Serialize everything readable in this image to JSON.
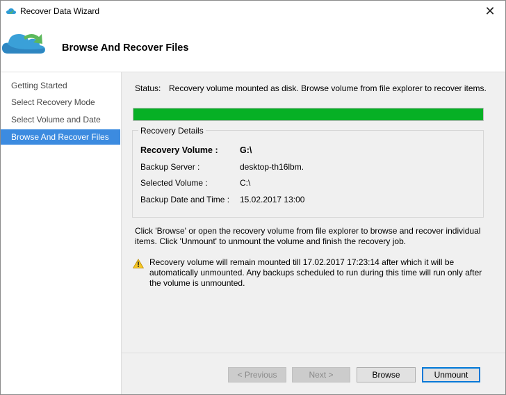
{
  "window": {
    "title": "Recover Data Wizard",
    "close_glyph": "✕"
  },
  "header": {
    "title": "Browse And Recover Files",
    "icon": "cloud-recover-icon"
  },
  "nav": {
    "items": [
      {
        "label": "Getting Started",
        "active": false
      },
      {
        "label": "Select Recovery Mode",
        "active": false
      },
      {
        "label": "Select Volume and Date",
        "active": false
      },
      {
        "label": "Browse And Recover Files",
        "active": true
      }
    ]
  },
  "status": {
    "label": "Status:",
    "text": "Recovery volume mounted as disk. Browse volume from file explorer to recover items.",
    "progress": 1.0,
    "progress_color": "#06b025"
  },
  "details": {
    "title": "Recovery Details",
    "rows": [
      {
        "label": "Recovery Volume :",
        "value": "G:\\"
      },
      {
        "label": "Backup Server :",
        "value": "desktop-th16lbm."
      },
      {
        "label": "Selected Volume :",
        "value": "C:\\"
      },
      {
        "label": "Backup Date and Time :",
        "value": "15.02.2017 13:00"
      }
    ]
  },
  "info_text": "Click 'Browse' or open the recovery volume from file explorer to browse and recover individual items. Click 'Unmount' to unmount the volume and finish the recovery job.",
  "warning": {
    "icon": "warning-icon",
    "text": "Recovery volume will remain mounted till 17.02.2017 17:23:14 after which it will be automatically unmounted. Any backups scheduled to run during this time will run only after the volume is unmounted."
  },
  "buttons": {
    "previous": "< Previous",
    "next": "Next >",
    "browse": "Browse",
    "unmount": "Unmount"
  }
}
